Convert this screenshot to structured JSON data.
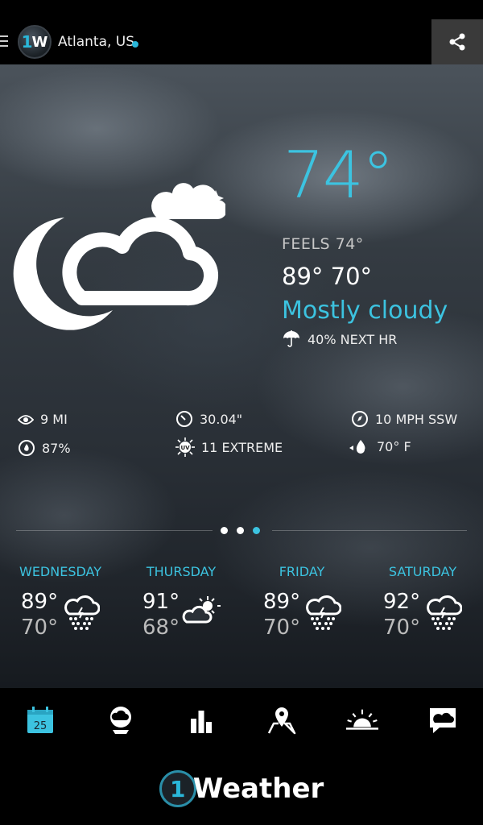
{
  "header": {
    "location": "Atlanta, US",
    "logo_text": "1W"
  },
  "current": {
    "temperature": "74°",
    "feels_like": "FEELS 74°",
    "high_low": "89° 70°",
    "condition": "Mostly cloudy",
    "precipitation": "40% NEXT HR",
    "icon": "night-cloudy-icon"
  },
  "details": {
    "visibility": "9 MI",
    "pressure": "30.04\"",
    "wind": "10 MPH SSW",
    "humidity": "87%",
    "uv": "11 EXTREME",
    "dew_point": "70° F"
  },
  "pager": {
    "count": 3,
    "active_index": 2
  },
  "forecast": [
    {
      "day": "WEDNESDAY",
      "high": "89°",
      "low": "70°",
      "icon": "thunderstorm-icon"
    },
    {
      "day": "THURSDAY",
      "high": "91°",
      "low": "68°",
      "icon": "partly-sunny-icon"
    },
    {
      "day": "FRIDAY",
      "high": "89°",
      "low": "70°",
      "icon": "thunderstorm-icon"
    },
    {
      "day": "SATURDAY",
      "high": "92°",
      "low": "70°",
      "icon": "thunderstorm-icon"
    }
  ],
  "bottom_nav": {
    "calendar_day": "25",
    "items": [
      "calendar-icon",
      "radar-globe-icon",
      "bar-chart-icon",
      "map-pin-icon",
      "sunrise-icon",
      "chat-alert-icon"
    ]
  },
  "brand": {
    "one": "1",
    "text": "Weather"
  },
  "colors": {
    "accent": "#3cc3e0",
    "background": "#000000"
  }
}
